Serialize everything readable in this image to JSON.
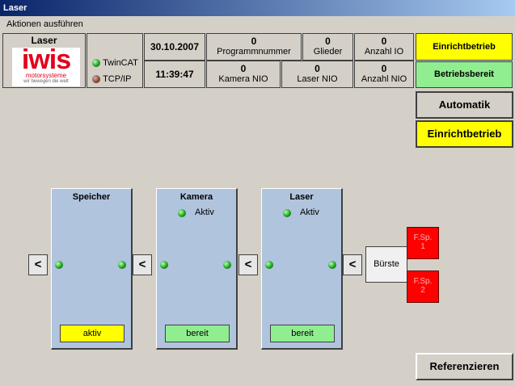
{
  "window": {
    "title": "Laser"
  },
  "menu": {
    "actions": "Aktionen ausführen"
  },
  "header": {
    "station_name": "Laser",
    "logo": {
      "brand": "iwis",
      "sub": "motorsysteme",
      "tagline": "wir bewegen die welt"
    },
    "connections": [
      {
        "label": "TwinCAT",
        "state": "ok"
      },
      {
        "label": "TCP/IP",
        "state": "off"
      }
    ],
    "date": "30.10.2007",
    "time": "11:39:47",
    "counters": {
      "programmnummer": {
        "value": "0",
        "label": "Programmnummer"
      },
      "glieder": {
        "value": "0",
        "label": "Glieder"
      },
      "anzahl_io": {
        "value": "0",
        "label": "Anzahl IO"
      },
      "kamera_nio": {
        "value": "0",
        "label": "Kamera NIO"
      },
      "laser_nio": {
        "value": "0",
        "label": "Laser NIO"
      },
      "anzahl_nio": {
        "value": "0",
        "label": "Anzahl NIO"
      }
    },
    "mode_status": "Einrichtbetrieb",
    "ready_status": "Betriebsbereit"
  },
  "controls": {
    "automatik": "Automatik",
    "einrichtbetrieb": "Einrichtbetrieb",
    "referenzieren": "Referenzieren"
  },
  "stations": [
    {
      "name": "Speicher",
      "active_label": "",
      "status": "aktiv"
    },
    {
      "name": "Kamera",
      "active_label": "Aktiv",
      "status": "bereit"
    },
    {
      "name": "Laser",
      "active_label": "Aktiv",
      "status": "bereit"
    }
  ],
  "arrow_label": "<",
  "brush": "Bürste",
  "fsp": [
    {
      "line1": "F.Sp.",
      "line2": "1"
    },
    {
      "line1": "F.Sp.",
      "line2": "2"
    }
  ],
  "colors": {
    "yellow": "#ffff00",
    "green_status": "#90ee90",
    "station_bg": "#b0c4de",
    "fault_red": "#ff0000"
  }
}
